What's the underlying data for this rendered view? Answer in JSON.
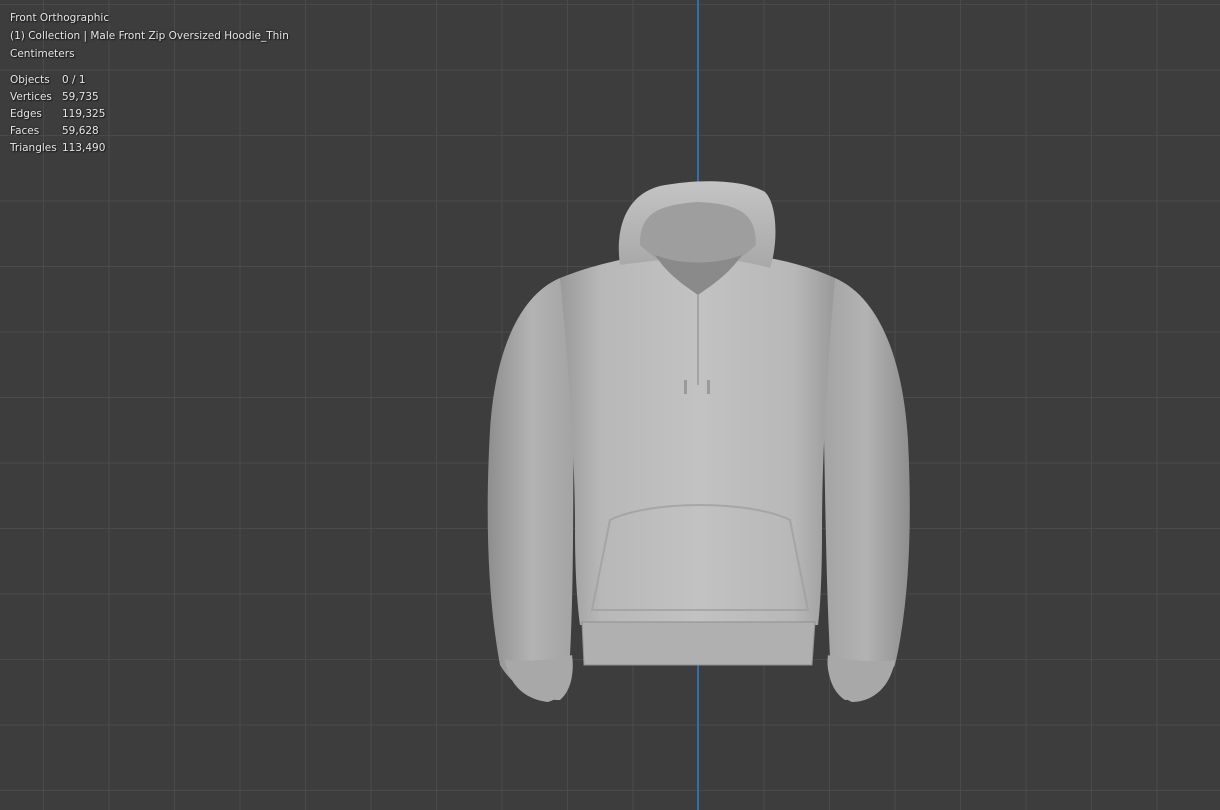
{
  "viewport": {
    "view_name": "Front Orthographic",
    "collection_label": "(1) Collection | Male Front Zip Oversized Hoodie_Thin",
    "units": "Centimeters"
  },
  "stats": [
    {
      "label": "Objects",
      "value": "0 / 1"
    },
    {
      "label": "Vertices",
      "value": "59,735"
    },
    {
      "label": "Edges",
      "value": "119,325"
    },
    {
      "label": "Faces",
      "value": "59,628"
    },
    {
      "label": "Triangles",
      "value": "113,490"
    }
  ],
  "colors": {
    "background": "#3d3d3d",
    "grid_line": "#4a4a4a",
    "z_axis": "#2f6fb1",
    "model": "#b5b5b5",
    "overlay_text": "#e6e6e6"
  }
}
